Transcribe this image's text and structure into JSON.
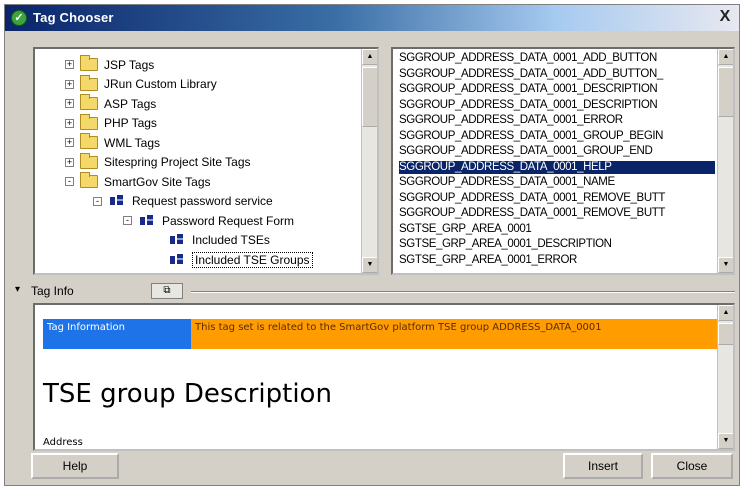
{
  "window": {
    "title": "Tag Chooser",
    "close_glyph": "X"
  },
  "tree": {
    "items": [
      {
        "label": "JSP Tags",
        "expander": "+",
        "icon": "folder-icon"
      },
      {
        "label": "JRun Custom Library",
        "expander": "+",
        "icon": "folder-icon"
      },
      {
        "label": "ASP Tags",
        "expander": "+",
        "icon": "folder-icon"
      },
      {
        "label": "PHP Tags",
        "expander": "+",
        "icon": "folder-icon"
      },
      {
        "label": "WML Tags",
        "expander": "+",
        "icon": "folder-icon"
      },
      {
        "label": "Sitespring Project Site Tags",
        "expander": "+",
        "icon": "folder-icon"
      },
      {
        "label": "SmartGov Site Tags",
        "expander": "-",
        "icon": "folder-icon"
      },
      {
        "label": "Request password service",
        "expander": "-",
        "icon": "tag-group-icon"
      },
      {
        "label": "Password Request Form",
        "expander": "-",
        "icon": "tag-group-icon"
      },
      {
        "label": "Included TSEs",
        "expander": "",
        "icon": "tag-group-icon"
      },
      {
        "label": "Included TSE Groups",
        "expander": "",
        "icon": "tag-group-icon"
      }
    ],
    "selected": "Included TSE Groups"
  },
  "taglist": {
    "items": [
      "SGGROUP_ADDRESS_DATA_0001_ADD_BUTTON",
      "SGGROUP_ADDRESS_DATA_0001_ADD_BUTTON_",
      "SGGROUP_ADDRESS_DATA_0001_DESCRIPTION",
      "SGGROUP_ADDRESS_DATA_0001_DESCRIPTION",
      "SGGROUP_ADDRESS_DATA_0001_ERROR",
      "SGGROUP_ADDRESS_DATA_0001_GROUP_BEGIN",
      "SGGROUP_ADDRESS_DATA_0001_GROUP_END",
      "SGGROUP_ADDRESS_DATA_0001_HELP",
      "SGGROUP_ADDRESS_DATA_0001_NAME",
      "SGGROUP_ADDRESS_DATA_0001_REMOVE_BUTT",
      "SGGROUP_ADDRESS_DATA_0001_REMOVE_BUTT",
      "SGTSE_GRP_AREA_0001",
      "SGTSE_GRP_AREA_0001_DESCRIPTION",
      "SGTSE_GRP_AREA_0001_ERROR"
    ],
    "selected_index": 7
  },
  "tabs": {
    "tag_info": "Tag Info",
    "arrow": "▾",
    "link_glyph": "⧉"
  },
  "info": {
    "key": "Tag Information",
    "value": "This tag set is related to the SmartGov platform TSE group ADDRESS_DATA_0001",
    "heading": "TSE group Description",
    "address_label": "Address"
  },
  "buttons": {
    "help": "Help",
    "insert": "Insert",
    "close": "Close"
  },
  "colors": {
    "selection": "#0a246a",
    "info_key_bg": "#1e73e8",
    "info_value_bg": "#ff9d00"
  }
}
